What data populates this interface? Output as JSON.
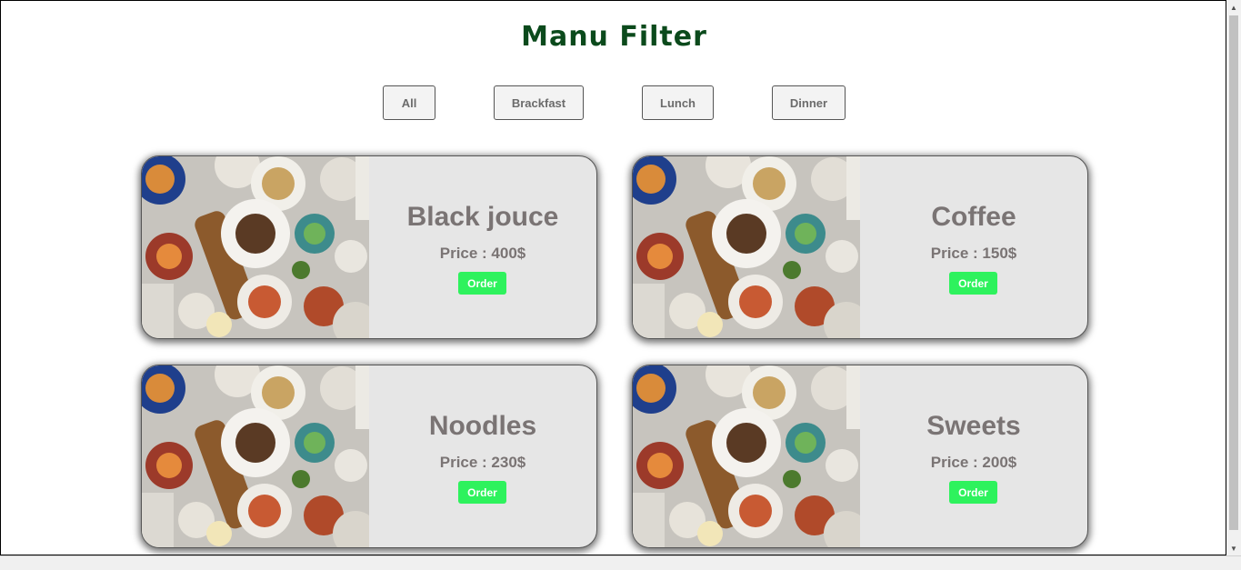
{
  "page": {
    "title": "Manu Filter"
  },
  "filters": [
    {
      "label": "All"
    },
    {
      "label": "Brackfast"
    },
    {
      "label": "Lunch"
    },
    {
      "label": "Dinner"
    }
  ],
  "menu": [
    {
      "name": "Black jouce",
      "price": "Price : 400$",
      "order_label": "Order"
    },
    {
      "name": "Coffee",
      "price": "Price : 150$",
      "order_label": "Order"
    },
    {
      "name": "Noodles",
      "price": "Price : 230$",
      "order_label": "Order"
    },
    {
      "name": "Sweets",
      "price": "Price : 200$",
      "order_label": "Order"
    }
  ],
  "colors": {
    "title": "#0b4a1c",
    "order_button": "#2ef25d",
    "card_background": "#e6e6e6",
    "card_text": "#7a7474"
  }
}
